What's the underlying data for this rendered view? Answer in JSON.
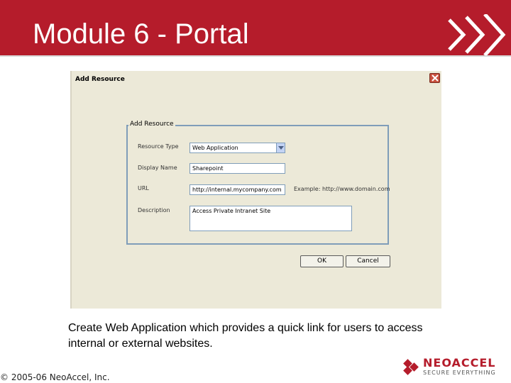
{
  "slide": {
    "title": "Module 6 - Portal",
    "caption_line1": "Create Web Application which provides a quick link for users to access",
    "caption_line2": "internal or external websites.",
    "copyright": "© 2005-06 NeoAccel, Inc.",
    "logo": {
      "brand": "NEOACCEL",
      "tagline": "SECURE EVERYTHING"
    }
  },
  "dialog": {
    "title": "Add Resource",
    "group_title": "Add Resource",
    "fields": [
      {
        "label": "Resource Type",
        "value": "Web Application",
        "kind": "select"
      },
      {
        "label": "Display Name",
        "value": "Sharepoint",
        "kind": "text"
      },
      {
        "label": "URL",
        "value": "http://internal.mycompany.com",
        "kind": "text"
      },
      {
        "label": "Description",
        "value": "Access Private Intranet Site",
        "kind": "textarea"
      }
    ],
    "url_example": "Example: http://www.domain.com",
    "ok_label": "OK",
    "cancel_label": "Cancel"
  },
  "colors": {
    "banner": "#b51c2b",
    "dialog_bg": "#ece9d8",
    "group_border": "#7f9db9"
  },
  "icons": [
    "close-icon",
    "dropdown-arrow-icon",
    "chevrons-icon",
    "neoaccel-logo-icon"
  ]
}
